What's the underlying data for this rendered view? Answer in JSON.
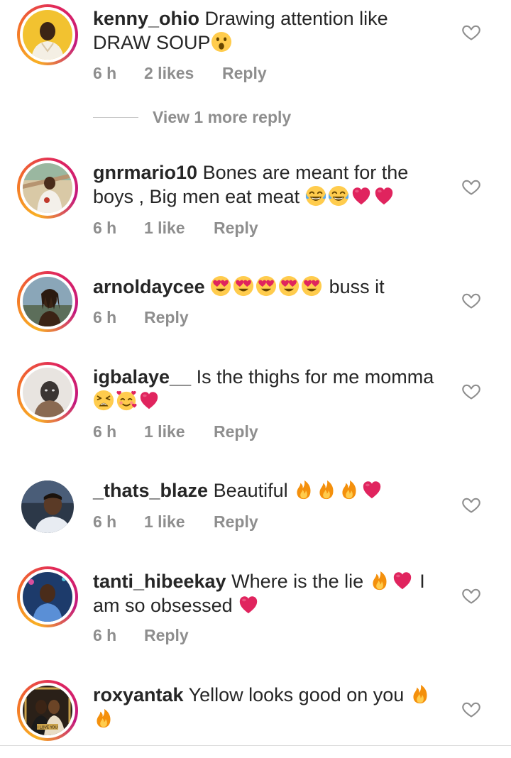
{
  "comments": [
    {
      "username": "kenny_ohio",
      "text": "Drawing attention like DRAW SOUP",
      "time": "6 h",
      "likes": "2 likes",
      "reply": "Reply",
      "emoji_icons": [
        "astonished-emoji"
      ]
    },
    {
      "username": "gnrmario10",
      "text": "Bones are meant for the boys , Big men eat meat",
      "time": "6 h",
      "likes": "1 like",
      "reply": "Reply",
      "emoji_icons": [
        "joy-emoji",
        "joy-emoji",
        "red-heart-emoji",
        "red-heart-emoji"
      ]
    },
    {
      "username": "arnoldaycee",
      "text": "buss it",
      "time": "6 h",
      "likes": "",
      "reply": "Reply",
      "emoji_icons": [
        "heart-eyes-emoji",
        "heart-eyes-emoji",
        "heart-eyes-emoji",
        "heart-eyes-emoji",
        "heart-eyes-emoji"
      ]
    },
    {
      "username": "igbalaye__",
      "text": "Is the thighs for me momma",
      "time": "6 h",
      "likes": "1 like",
      "reply": "Reply",
      "emoji_icons": [
        "tired-face-emoji",
        "smiling-hearts-emoji",
        "red-heart-emoji"
      ]
    },
    {
      "username": "_thats_blaze",
      "text": "Beautiful",
      "time": "6 h",
      "likes": "1 like",
      "reply": "Reply",
      "emoji_icons": [
        "fire-emoji",
        "fire-emoji",
        "fire-emoji",
        "red-heart-emoji"
      ]
    },
    {
      "username": "tanti_hibeekay",
      "text": "Where is the lie",
      "text_after": "I am so obsessed",
      "time": "6 h",
      "likes": "",
      "reply": "Reply",
      "emoji_icons": [
        "fire-emoji",
        "red-heart-emoji",
        "red-heart-emoji"
      ]
    },
    {
      "username": "roxyantak",
      "text": "Yellow looks good on you",
      "time": "",
      "likes": "",
      "reply": "",
      "emoji_icons": [
        "fire-emoji",
        "fire-emoji"
      ]
    }
  ],
  "view_more": "View 1 more reply",
  "avatar_label": "I LOVE YOU",
  "colors": {
    "text": "#262626",
    "secondary": "#8e8e8e",
    "story_ring": "#e0265d",
    "heart": "#e0245e",
    "fire": "#f7931e"
  }
}
